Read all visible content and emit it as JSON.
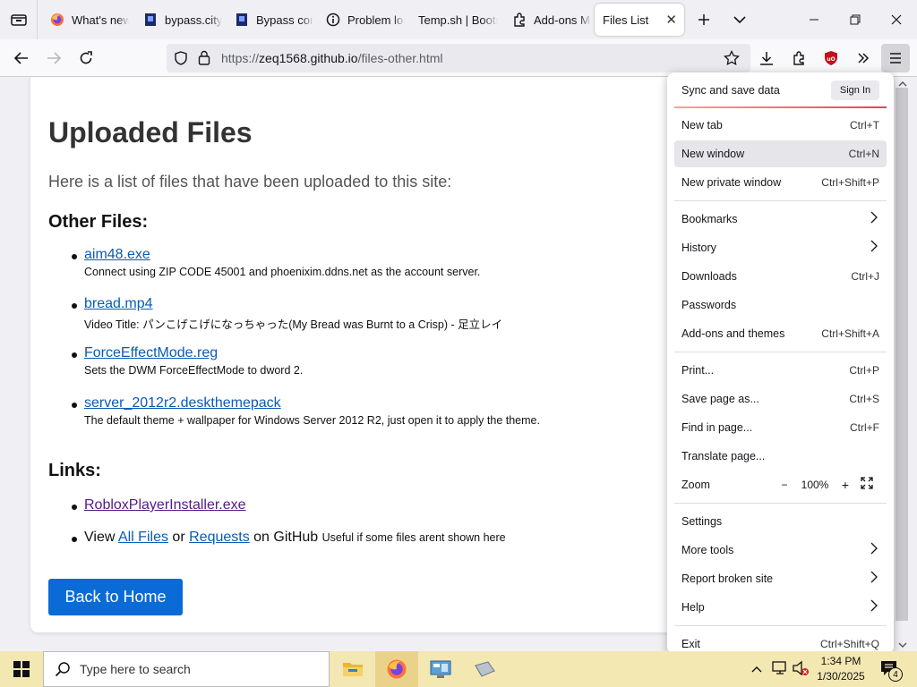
{
  "tabs": [
    {
      "title": "What's new",
      "icon": "firefox-icon"
    },
    {
      "title": "bypass.city",
      "icon": "bypass-icon"
    },
    {
      "title": "Bypass config",
      "icon": "bypass-icon"
    },
    {
      "title": "Problem loading",
      "icon": "info-icon"
    },
    {
      "title": "Temp.sh | Bootstrap",
      "icon": "none"
    },
    {
      "title": "Add-ons Manager",
      "icon": "puzzle-icon"
    },
    {
      "title": "Files List",
      "icon": "none",
      "active": true
    }
  ],
  "address": {
    "protocol": "https://",
    "host": "zeq1568.github.io",
    "path": "/files-other.html"
  },
  "page": {
    "title": "Uploaded Files",
    "intro": "Here is a list of files that have been uploaded to this site:",
    "other_heading": "Other Files:",
    "files": [
      {
        "name": "aim48.exe",
        "desc": "Connect using ZIP CODE 45001 and phoenixim.ddns.net as the account server."
      },
      {
        "name": "bread.mp4",
        "desc": "Video Title: パンこげこげになっちゃった(My Bread was Burnt to a Crisp) - 足立レイ"
      },
      {
        "name": "ForceEffectMode.reg",
        "desc": "Sets the DWM ForceEffectMode to dword 2."
      },
      {
        "name": "server_2012r2.deskthemepack",
        "desc": "The default theme + wallpaper for Windows Server 2012 R2, just open it to apply the theme."
      }
    ],
    "links_heading": "Links:",
    "links": {
      "roblox": "RobloxPlayerInstaller.exe",
      "view": "View",
      "all_files": "All Files",
      "or": "or",
      "requests": "Requests",
      "on_github": "on GitHub",
      "note": "Useful if some files arent shown here"
    },
    "home_button": "Back to Home"
  },
  "menu": {
    "sync": "Sync and save data",
    "sign_in": "Sign In",
    "items": [
      {
        "label": "New tab",
        "shortcut": "Ctrl+T"
      },
      {
        "label": "New window",
        "shortcut": "Ctrl+N"
      },
      {
        "label": "New private window",
        "shortcut": "Ctrl+Shift+P"
      },
      {
        "label": "Bookmarks",
        "shortcut": ""
      },
      {
        "label": "History",
        "shortcut": ""
      },
      {
        "label": "Downloads",
        "shortcut": "Ctrl+J"
      },
      {
        "label": "Passwords",
        "shortcut": ""
      },
      {
        "label": "Add-ons and themes",
        "shortcut": "Ctrl+Shift+A"
      },
      {
        "label": "Print...",
        "shortcut": "Ctrl+P"
      },
      {
        "label": "Save page as...",
        "shortcut": "Ctrl+S"
      },
      {
        "label": "Find in page...",
        "shortcut": "Ctrl+F"
      },
      {
        "label": "Translate page...",
        "shortcut": ""
      },
      {
        "label": "Zoom",
        "shortcut": ""
      },
      {
        "label": "Settings",
        "shortcut": ""
      },
      {
        "label": "More tools",
        "shortcut": ""
      },
      {
        "label": "Report broken site",
        "shortcut": ""
      },
      {
        "label": "Help",
        "shortcut": ""
      },
      {
        "label": "Exit",
        "shortcut": "Ctrl+Shift+Q"
      }
    ],
    "zoom": {
      "minus": "−",
      "level": "100%",
      "plus": "+"
    }
  },
  "taskbar": {
    "search_placeholder": "Type here to search",
    "time": "1:34 PM",
    "date": "1/30/2025",
    "notification_count": "4"
  },
  "colors": {
    "accent": "#0a6bd6",
    "link": "#0a5bb5",
    "visited": "#551a8b",
    "taskbar": "#f3e7b2",
    "ublock": "#c4101b"
  }
}
